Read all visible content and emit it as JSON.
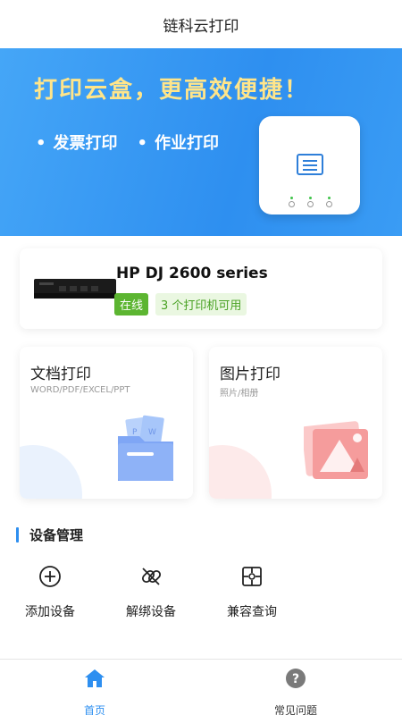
{
  "header": {
    "title": "链科云打印"
  },
  "banner": {
    "headline": "打印云盒，更高效便捷！",
    "bullets": [
      "发票打印",
      "作业打印"
    ]
  },
  "printer": {
    "name": "HP DJ 2600 series",
    "status": "在线",
    "available": "3 个打印机可用"
  },
  "tiles": [
    {
      "title": "文档打印",
      "subtitle": "WORD/PDF/EXCEL/PPT"
    },
    {
      "title": "图片打印",
      "subtitle": "照片/相册"
    }
  ],
  "section": {
    "title": "设备管理"
  },
  "actions": [
    {
      "label": "添加设备",
      "icon": "add-circle-icon"
    },
    {
      "label": "解绑设备",
      "icon": "unlink-icon"
    },
    {
      "label": "兼容查询",
      "icon": "puzzle-icon"
    }
  ],
  "tabbar": [
    {
      "label": "首页",
      "icon": "home-icon",
      "active": true
    },
    {
      "label": "常见问题",
      "icon": "question-icon",
      "active": false
    }
  ],
  "colors": {
    "accent": "#2e8ff0",
    "online": "#5cb531",
    "headline": "#ffe58a"
  }
}
